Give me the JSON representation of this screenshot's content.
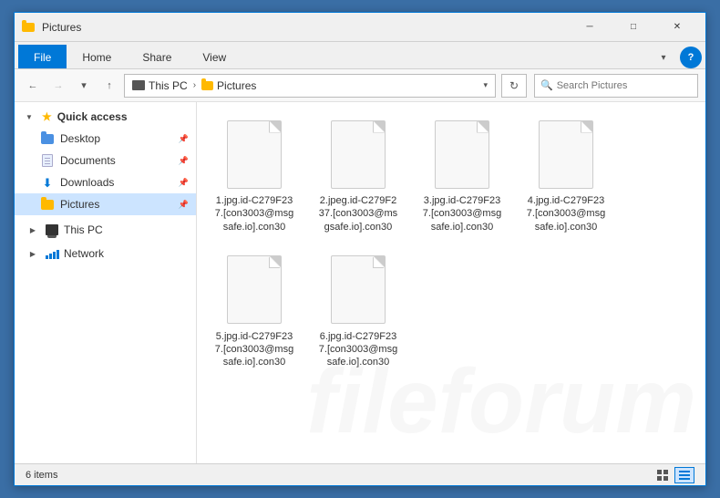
{
  "window": {
    "title": "Pictures",
    "icon": "folder-icon"
  },
  "titlebar": {
    "minimize_label": "─",
    "maximize_label": "□",
    "close_label": "✕"
  },
  "ribbon": {
    "tabs": [
      {
        "id": "file",
        "label": "File",
        "active": true
      },
      {
        "id": "home",
        "label": "Home",
        "active": false
      },
      {
        "id": "share",
        "label": "Share",
        "active": false
      },
      {
        "id": "view",
        "label": "View",
        "active": false
      }
    ],
    "expand_icon": "▾",
    "help_label": "?"
  },
  "navbar": {
    "back_label": "←",
    "forward_label": "→",
    "recent_label": "▾",
    "up_label": "↑",
    "breadcrumb": [
      {
        "label": "This PC",
        "icon": "pc-icon"
      },
      {
        "label": "Pictures",
        "icon": "folder-icon"
      }
    ],
    "chevron_label": "▾",
    "refresh_label": "↻",
    "search_placeholder": "Search Pictures"
  },
  "sidebar": {
    "sections": [
      {
        "id": "quick-access",
        "label": "Quick access",
        "icon": "star-icon",
        "items": [
          {
            "id": "desktop",
            "label": "Desktop",
            "icon": "folder-blue-icon",
            "pinned": true
          },
          {
            "id": "documents",
            "label": "Documents",
            "icon": "docs-icon",
            "pinned": true
          },
          {
            "id": "downloads",
            "label": "Downloads",
            "icon": "download-icon",
            "pinned": true
          },
          {
            "id": "pictures",
            "label": "Pictures",
            "icon": "folder-icon",
            "pinned": true,
            "active": true
          }
        ]
      },
      {
        "id": "this-pc",
        "label": "This PC",
        "icon": "pc-icon",
        "items": []
      },
      {
        "id": "network",
        "label": "Network",
        "icon": "network-icon",
        "items": []
      }
    ]
  },
  "files": [
    {
      "id": "file1",
      "name": "1.jpg.id-C279F23\n7.[con3003@msg\nsafe.io].con30",
      "display_name": "1.jpg.id-C279F237.[con3003@msgsafe.io].con30"
    },
    {
      "id": "file2",
      "name": "2.jpeg.id-C279F2\n37.[con3003@ms\ngsafe.io].con30",
      "display_name": "2.jpeg.id-C279F237.[con3003@msgsafe.io].con30"
    },
    {
      "id": "file3",
      "name": "3.jpg.id-C279F23\n7.[con3003@msg\nsafe.io].con30",
      "display_name": "3.jpg.id-C279F237.[con3003@msgsafe.io].con30"
    },
    {
      "id": "file4",
      "name": "4.jpg.id-C279F23\n7.[con3003@msg\nsafe.io].con30",
      "display_name": "4.jpg.id-C279F237.[con3003@msgsafe.io].con30"
    },
    {
      "id": "file5",
      "name": "5.jpg.id-C279F23\n7.[con3003@msg\nsafe.io].con30",
      "display_name": "5.jpg.id-C279F237.[con3003@msgsafe.io].con30"
    },
    {
      "id": "file6",
      "name": "6.jpg.id-C279F23\n7.[con3003@msg\nsafe.io].con30",
      "display_name": "6.jpg.id-C279F237.[con3003@msgsafe.io].con30"
    }
  ],
  "statusbar": {
    "item_count": "6 items",
    "grid_view_icon": "▦",
    "list_view_icon": "☰"
  }
}
